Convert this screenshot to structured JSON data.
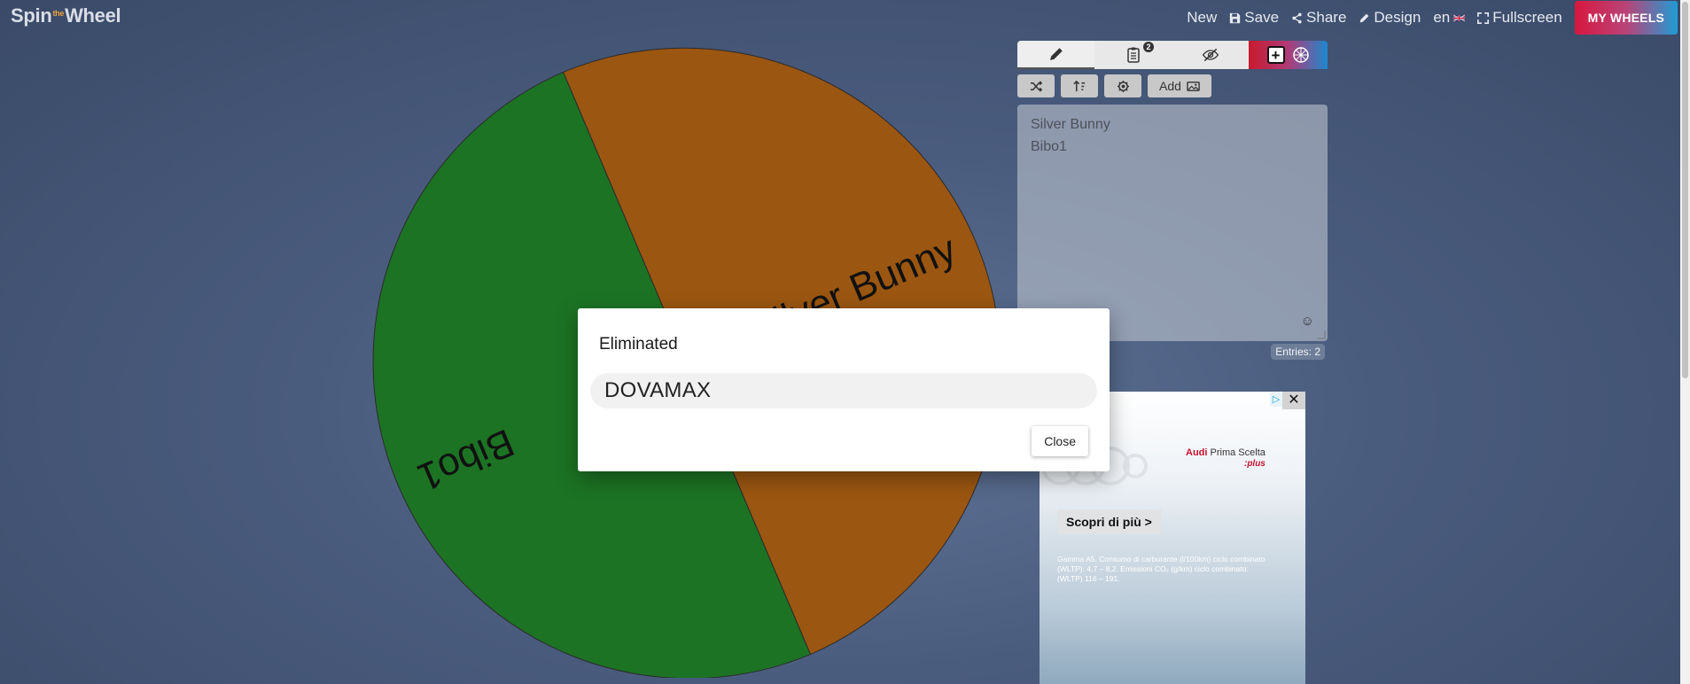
{
  "app": {
    "logo_left": "Spin",
    "logo_small": "the",
    "logo_right": "Wheel"
  },
  "topnav": {
    "new": "New",
    "save": "Save",
    "share": "Share",
    "design": "Design",
    "language": "en",
    "fullscreen": "Fullscreen",
    "my_wheels": "MY WHEELS"
  },
  "wheel": {
    "segments": [
      {
        "label": "Silver Bunny",
        "color": "#9b5611"
      },
      {
        "label": "Bibo1",
        "color": "#1c7324"
      }
    ]
  },
  "panel": {
    "tabs": [
      {
        "name": "edit",
        "icon": "pencil-icon"
      },
      {
        "name": "results",
        "icon": "clipboard-list-icon",
        "badge": "2"
      },
      {
        "name": "hide",
        "icon": "eye-slash-icon"
      },
      {
        "name": "add-wheel",
        "icon": "plus-icon"
      }
    ],
    "toolbar": {
      "add_image_label": "Add"
    },
    "entries": [
      "Silver Bunny",
      "Bibo1"
    ],
    "entries_count": "Entries: 2"
  },
  "ad": {
    "brand_name": "Audi",
    "brand_tagline": "Prima Scelta",
    "brand_plus": ":plus",
    "cta": "Scopri di più >",
    "fineprint": "Gamma A5. Consumo di carburante (l/100km) ciclo combinato (WLTP): 4,7 – 8,2. Emissioni CO₂ (g/km) ciclo combinato: (WLTP) 116 – 191."
  },
  "dialog": {
    "title": "Eliminated",
    "winner": "DOVAMAX",
    "close_label": "Close"
  },
  "colors": {
    "accent_red": "#d8173f",
    "accent_blue": "#1f9bd6",
    "background": "#4a5c7e"
  }
}
